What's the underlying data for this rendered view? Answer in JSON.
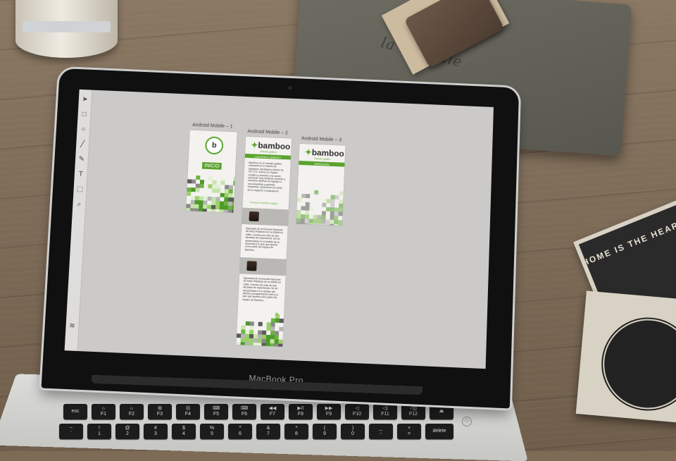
{
  "desk": {
    "pouch_text": "la libellule",
    "coaster_text": "HOME IS THE HEART OF THE HOLIDAYS"
  },
  "laptop": {
    "brand_label": "MacBook Pro"
  },
  "toolbar": {
    "tools": [
      {
        "name": "select-arrow-icon",
        "glyph": "➤"
      },
      {
        "name": "rectangle-icon",
        "glyph": "□"
      },
      {
        "name": "ellipse-icon",
        "glyph": "○"
      },
      {
        "name": "line-icon",
        "glyph": "╱"
      },
      {
        "name": "pen-icon",
        "glyph": "✎"
      },
      {
        "name": "text-icon",
        "glyph": "T"
      },
      {
        "name": "artboard-icon",
        "glyph": "⬚"
      },
      {
        "name": "zoom-icon",
        "glyph": "⌕"
      }
    ],
    "bottom_tool": {
      "name": "layers-icon",
      "glyph": "≋"
    }
  },
  "artboards": [
    {
      "label": "Android Mobile – 1",
      "button": "INICIO"
    },
    {
      "label": "Android Mobile – 2",
      "logo": "bamboo",
      "logo_sub": "Estudio gráfico",
      "section": "¿QUIENES SOMOS?",
      "intro_text": "Bamboo es un estudio gráfico enfocado en el diseño de logotipos, identidad y diseño de CV. S.A. Somos un equipo creativo y honesto a la suerte personal. Hoy estamos creando y nuestros diseños de logotipo a sus pequeñas y grandes empresas. Queremos ser parte de tu negocio! Contáctanos!",
      "link": "Conoce a nuestro equipo",
      "member1_text": "Egresada de la Escuela Nacional de Artes Plásticas de la UNAM en 1986. Cuenta con más de dos décadas de experiencia. Se ha desarrollado en el ámbito de la docencia y lo que que aporta como parte del equipo de Bamboo.",
      "member2_text": "Egresada de la Escuela Nacional de Artes Plásticas de la UNAM en 1986. Cuenta con más de dos décadas de experiencia. Se ha desarrollado en el ámbito del diseño y programación web y lo que que aporta como parte del equipo de Bamboo."
    },
    {
      "label": "Android Mobile – 3",
      "logo": "bamboo",
      "logo_sub": "Estudio gráfico",
      "section": "SERVICIOS"
    }
  ],
  "keyboard": {
    "row1": [
      "esc",
      "☼ F1",
      "☼ F2",
      "⊞ F3",
      "⊟ F4",
      "⌨ F5",
      "⌨ F6",
      "◀◀ F7",
      "▶II F8",
      "▶▶ F9",
      "◁ F10",
      "◁) F11",
      "◁)) F12",
      "⏏"
    ],
    "row2": [
      "~ `",
      "! 1",
      "@ 2",
      "# 3",
      "$ 4",
      "% 5",
      "^ 6",
      "& 7",
      "* 8",
      "( 9",
      ") 0",
      "_ -",
      "+ =",
      "delete"
    ]
  },
  "colors": {
    "accent_green": "#5aa42e",
    "canvas_bg": "#cbcac8"
  }
}
